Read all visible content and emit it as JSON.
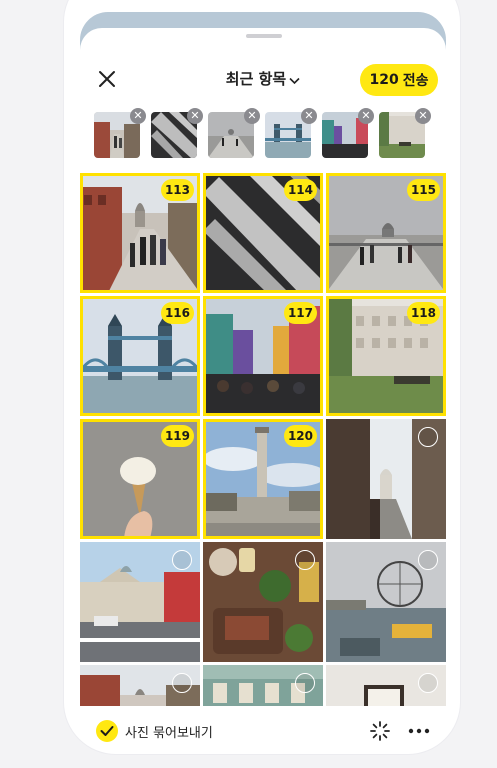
{
  "header": {
    "title": "최근 항목",
    "send_count": "120",
    "send_label": "전송"
  },
  "selected_thumbs": [
    {
      "name": "thumb-st-pauls-walkway"
    },
    {
      "name": "thumb-concrete-steps"
    },
    {
      "name": "thumb-millennium-bridge"
    },
    {
      "name": "thumb-tower-bridge"
    },
    {
      "name": "thumb-portobello-road"
    },
    {
      "name": "thumb-park-building"
    }
  ],
  "grid": {
    "badges": [
      "113",
      "114",
      "115",
      "116",
      "117",
      "118",
      "119",
      "120"
    ]
  },
  "footer": {
    "bundle_label": "사진 묶어보내기"
  },
  "colors": {
    "accent": "#ffe812",
    "selection_border": "#ffe100",
    "backdrop": "#b7c8d6"
  },
  "icons": [
    "close-icon",
    "chevron-down-icon",
    "remove-thumb-icon",
    "check-icon",
    "sparkle-icon",
    "more-icon"
  ]
}
